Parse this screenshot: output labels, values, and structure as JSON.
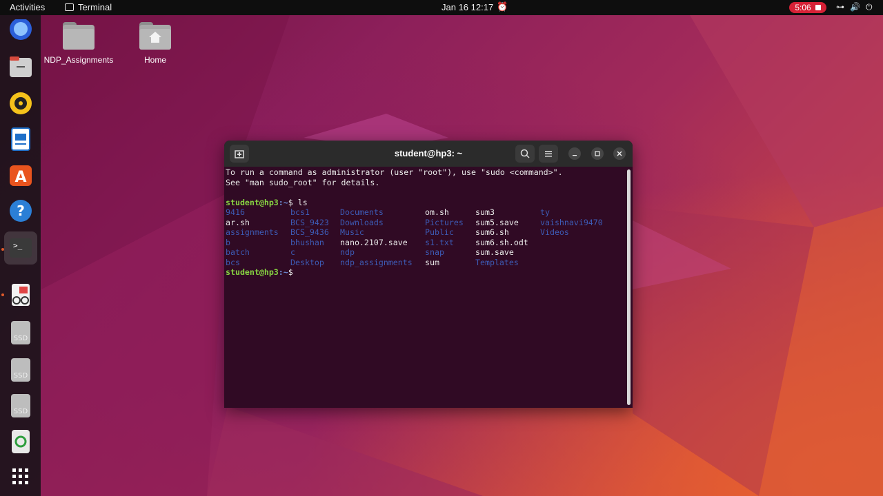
{
  "topbar": {
    "activities": "Activities",
    "app_name": "Terminal",
    "clock": "Jan 16  12:17",
    "recording_time": "5:06"
  },
  "dock": {
    "items": [
      "firefox-icon",
      "files-icon",
      "rhythmbox-icon",
      "libreoffice-writer-icon",
      "app-center-icon",
      "help-icon",
      "terminal-icon",
      "document-viewer-icon",
      "ssd-drive-icon",
      "ssd-drive-icon",
      "ssd-drive-icon",
      "trash-icon",
      "show-apps-icon"
    ],
    "ssd_label": "SSD"
  },
  "desktop": {
    "icons": [
      {
        "label": "NDP_Assignments"
      },
      {
        "label": "Home"
      }
    ]
  },
  "terminal": {
    "title": "student@hp3: ~",
    "intro_line1": "To run a command as administrator (user \"root\"), use \"sudo <command>\".",
    "intro_line2": "See \"man sudo_root\" for details.",
    "prompt_user": "student@hp3",
    "prompt_path": ":~",
    "prompt_symbol": "$ ",
    "command": "ls",
    "ls_rows": [
      [
        {
          "t": "9416",
          "k": "dir"
        },
        {
          "t": "bcs1",
          "k": "dir"
        },
        {
          "t": "Documents",
          "k": "dir"
        },
        {
          "t": "om.sh",
          "k": "file"
        },
        {
          "t": "sum3",
          "k": "file"
        },
        {
          "t": "ty",
          "k": "dir"
        }
      ],
      [
        {
          "t": "ar.sh",
          "k": "file"
        },
        {
          "t": "BCS_9423",
          "k": "dir"
        },
        {
          "t": "Downloads",
          "k": "dir"
        },
        {
          "t": "Pictures",
          "k": "dir"
        },
        {
          "t": "sum5.save",
          "k": "file"
        },
        {
          "t": "vaishnavi9470",
          "k": "dir"
        }
      ],
      [
        {
          "t": "assignments",
          "k": "dir"
        },
        {
          "t": "BCS_9436",
          "k": "dir"
        },
        {
          "t": "Music",
          "k": "dir"
        },
        {
          "t": "Public",
          "k": "dir"
        },
        {
          "t": "sum6.sh",
          "k": "file"
        },
        {
          "t": "Videos",
          "k": "dir"
        }
      ],
      [
        {
          "t": "b",
          "k": "dir"
        },
        {
          "t": "bhushan",
          "k": "dir"
        },
        {
          "t": "nano.2107.save",
          "k": "file"
        },
        {
          "t": "s1.txt",
          "k": "dir"
        },
        {
          "t": "sum6.sh.odt",
          "k": "file"
        },
        {
          "t": "",
          "k": "file"
        }
      ],
      [
        {
          "t": "batch",
          "k": "dir"
        },
        {
          "t": "c",
          "k": "dir"
        },
        {
          "t": "ndp",
          "k": "dir"
        },
        {
          "t": "snap",
          "k": "dir"
        },
        {
          "t": "sum.save",
          "k": "file"
        },
        {
          "t": "",
          "k": "file"
        }
      ],
      [
        {
          "t": "bcs",
          "k": "dir"
        },
        {
          "t": "Desktop",
          "k": "dir"
        },
        {
          "t": "ndp_assignments",
          "k": "dir"
        },
        {
          "t": "sum",
          "k": "file"
        },
        {
          "t": "Templates",
          "k": "dir"
        },
        {
          "t": "",
          "k": "file"
        }
      ]
    ]
  }
}
